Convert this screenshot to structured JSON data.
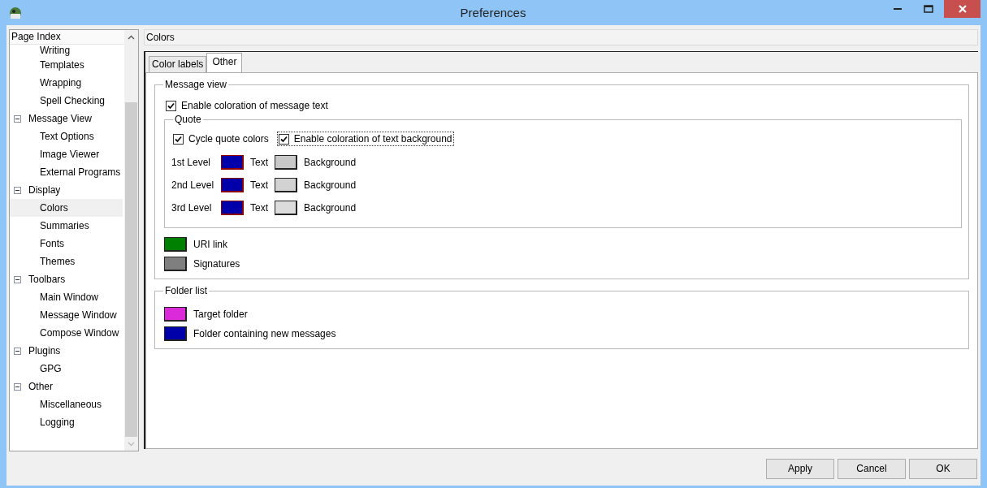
{
  "window": {
    "title": "Preferences"
  },
  "sidebar": {
    "header": "Page Index",
    "items": [
      {
        "children": [
          {
            "label": "Writing",
            "selected": false
          },
          {
            "label": "Templates",
            "selected": false
          },
          {
            "label": "Wrapping",
            "selected": false
          },
          {
            "label": "Spell Checking",
            "selected": false
          }
        ]
      },
      {
        "label": "Message View",
        "expanded": true,
        "selected": false,
        "children": [
          {
            "label": "Text Options",
            "selected": false
          },
          {
            "label": "Image Viewer",
            "selected": false
          },
          {
            "label": "External Programs",
            "selected": false
          }
        ]
      },
      {
        "label": "Display",
        "expanded": true,
        "selected": false,
        "children": [
          {
            "label": "Colors",
            "selected": true
          },
          {
            "label": "Summaries",
            "selected": false
          },
          {
            "label": "Fonts",
            "selected": false
          },
          {
            "label": "Themes",
            "selected": false
          }
        ]
      },
      {
        "label": "Toolbars",
        "expanded": true,
        "selected": false,
        "children": [
          {
            "label": "Main Window",
            "selected": false
          },
          {
            "label": "Message Window",
            "selected": false
          },
          {
            "label": "Compose Window",
            "selected": false
          }
        ]
      },
      {
        "label": "Plugins",
        "expanded": true,
        "selected": false,
        "children": [
          {
            "label": "GPG",
            "selected": false
          }
        ]
      },
      {
        "label": "Other",
        "expanded": true,
        "selected": false,
        "children": [
          {
            "label": "Miscellaneous",
            "selected": false
          },
          {
            "label": "Logging",
            "selected": false
          }
        ]
      }
    ]
  },
  "page_title": "Colors",
  "tabs": [
    {
      "label": "Color labels",
      "selected": false
    },
    {
      "label": "Other",
      "selected": true
    }
  ],
  "message_view": {
    "title": "Message view",
    "enable": {
      "label": "Enable coloration of message text",
      "checked": true
    },
    "quote": {
      "title": "Quote",
      "options": [
        {
          "label": "Cycle quote colors",
          "checked": true,
          "focused": false
        },
        {
          "label": "Enable coloration of text background",
          "checked": true,
          "focused": true
        }
      ],
      "levels": [
        {
          "label": "1st Level",
          "text": {
            "label": "Text",
            "color": "#0000aa"
          },
          "background": {
            "label": "Background",
            "color": "#c8c8c8"
          }
        },
        {
          "label": "2nd Level",
          "text": {
            "label": "Text",
            "color": "#0000aa"
          },
          "background": {
            "label": "Background",
            "color": "#d2d2d2"
          }
        },
        {
          "label": "3rd Level",
          "text": {
            "label": "Text",
            "color": "#0000aa"
          },
          "background": {
            "label": "Background",
            "color": "#dcdcdc"
          }
        }
      ]
    },
    "colors": [
      {
        "label": "URI link",
        "color": "#008000"
      },
      {
        "label": "Signatures",
        "color": "#7f7f7f"
      }
    ]
  },
  "folder_list": {
    "title": "Folder list",
    "colors": [
      {
        "label": "Target folder",
        "color": "#da2ada"
      },
      {
        "label": "Folder containing new messages",
        "color": "#0000aa"
      }
    ]
  },
  "buttons": [
    "Apply",
    "Cancel",
    "OK"
  ]
}
